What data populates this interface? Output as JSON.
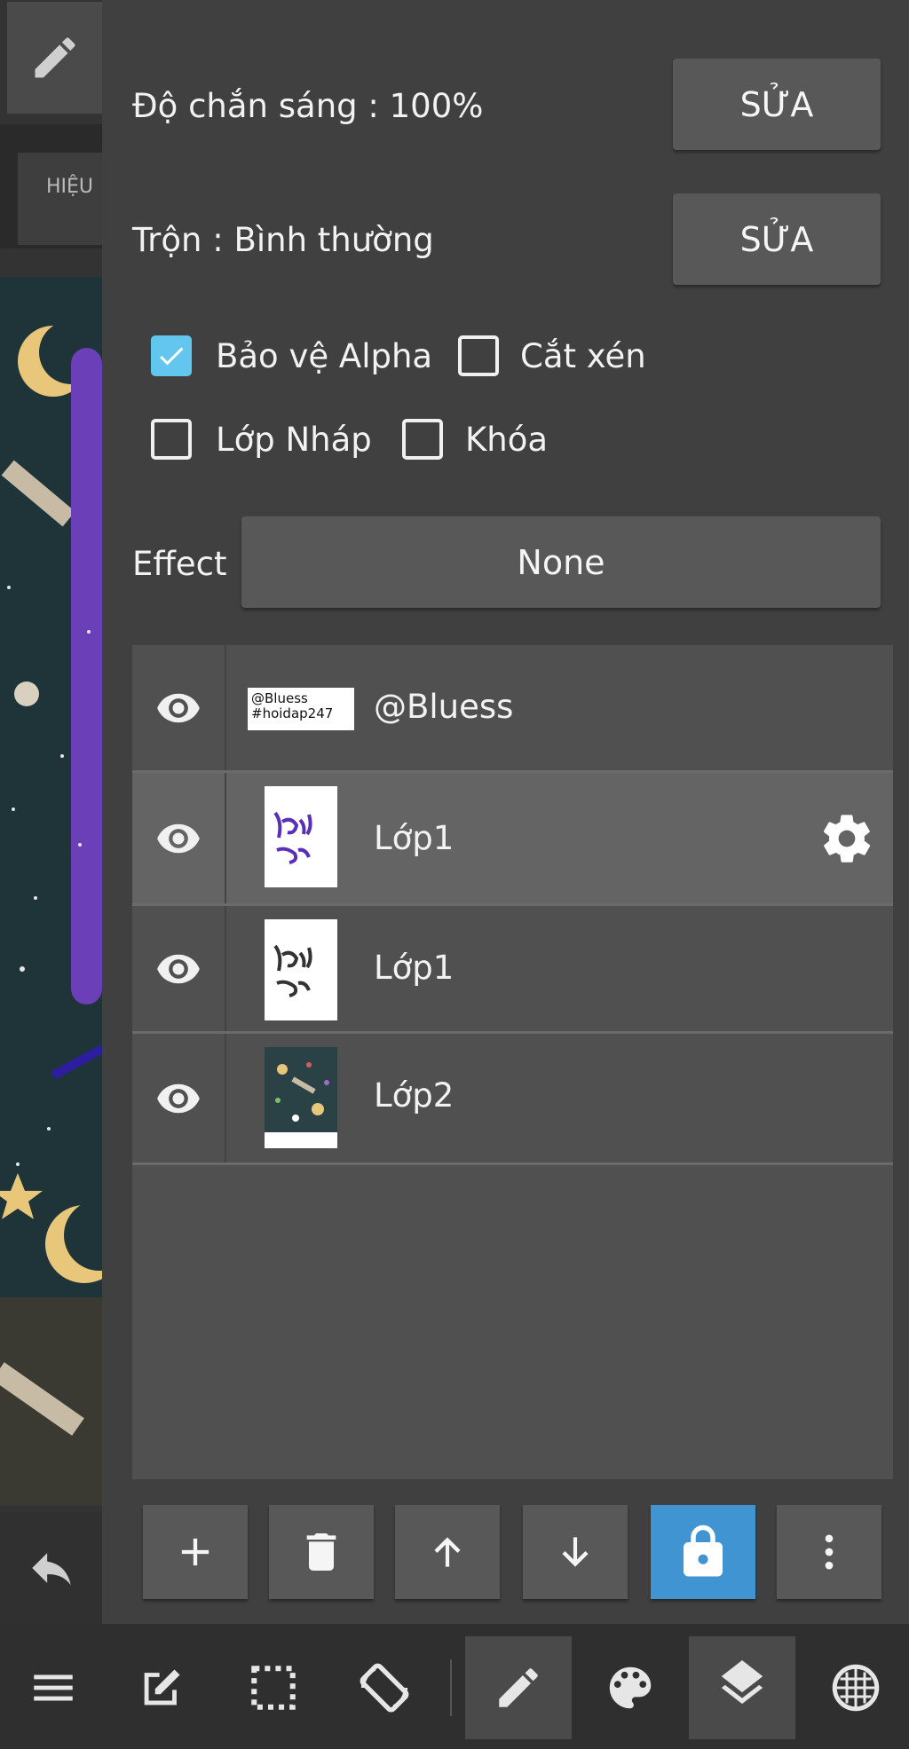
{
  "canvas": {
    "effect_tab_label": "HIỆU"
  },
  "settings": {
    "opacity_label": "Độ chắn sáng : 100%",
    "opacity_edit": "SỬA",
    "blend_label": "Trộn : Bình thường",
    "blend_edit": "SỬA",
    "alpha_protect_label": "Bảo vệ Alpha",
    "alpha_protect_checked": true,
    "clipping_label": "Cắt xén",
    "clipping_checked": false,
    "draft_label": "Lớp Nháp",
    "draft_checked": false,
    "lock_label": "Khóa",
    "lock_checked": false,
    "effect_label": "Effect",
    "effect_value": "None"
  },
  "layers": [
    {
      "name": "@Bluess",
      "thumb_text": [
        "@Bluess",
        "#hoidap247"
      ],
      "visible": true,
      "selected": false
    },
    {
      "name": "Lớp1",
      "visible": true,
      "selected": true
    },
    {
      "name": "Lớp1",
      "visible": true,
      "selected": false
    },
    {
      "name": "Lớp2",
      "visible": true,
      "selected": false
    }
  ],
  "layer_actions": [
    "add-layer",
    "delete-layer",
    "move-up",
    "move-down",
    "lock-layer",
    "more-options"
  ],
  "toolbar": [
    "menu",
    "edit",
    "selection",
    "rotate-canvas",
    "brush",
    "color-palette",
    "layers",
    "materials"
  ],
  "colors": {
    "panel_bg": "#404040",
    "list_bg": "#505050",
    "selected_row": "#646464",
    "checkbox_accent": "#62c6ee",
    "lock_active": "#3f94d1"
  }
}
